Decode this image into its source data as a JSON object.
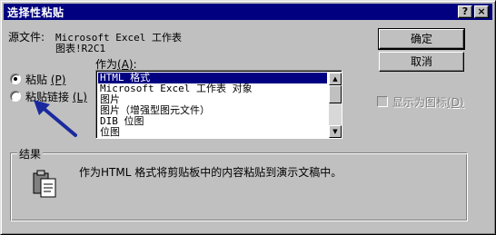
{
  "window": {
    "title": "选择性粘贴",
    "help_label": "?",
    "close_label": "×"
  },
  "source": {
    "label": "源文件:",
    "line1": "Microsoft Excel 工作表",
    "line2": "图表!R2C1"
  },
  "paste_options": {
    "paste_label": "粘贴",
    "paste_hotkey": "(P)",
    "paste_selected": true,
    "link_label": "粘贴链接",
    "link_hotkey": "(L)",
    "link_selected": false
  },
  "as_list": {
    "label": "作为",
    "hotkey": "(A)",
    "colon": ":",
    "items": [
      "HTML 格式",
      "Microsoft Excel 工作表 对象",
      "图片",
      "图片（增强型图元文件）",
      "DIB 位图",
      "位图"
    ],
    "selected_index": 0
  },
  "buttons": {
    "ok_label": "确定",
    "cancel_label": "取消"
  },
  "display_as_icon": {
    "label": "显示为图标",
    "hotkey": "(D)",
    "checked": false,
    "enabled": false
  },
  "result": {
    "label": "结果",
    "text": "作为HTML 格式将剪贴板中的内容粘贴到演示文稿中。"
  },
  "colors": {
    "titlebar": "#000080",
    "face": "#c0c0c0",
    "selection": "#000080",
    "arrow": "#1a2a9e"
  }
}
